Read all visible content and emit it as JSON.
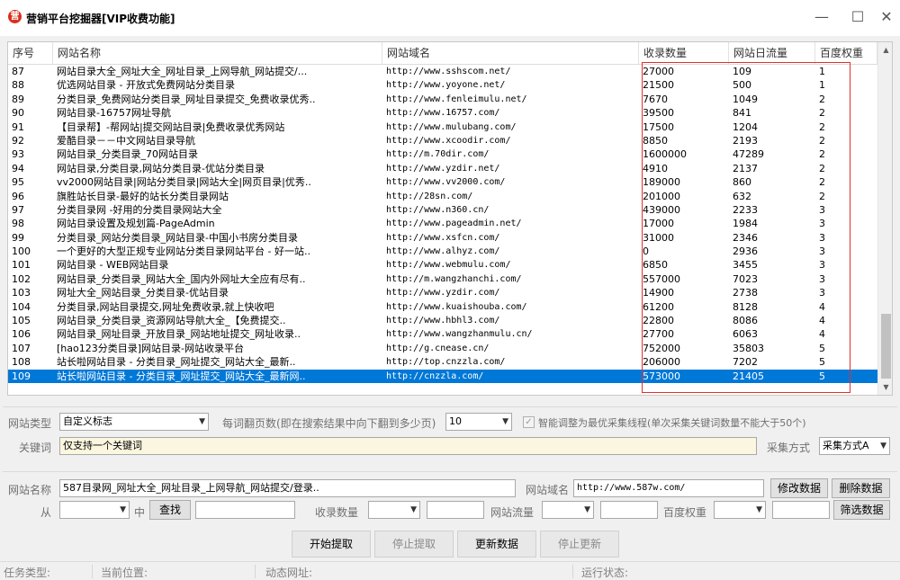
{
  "window": {
    "title": "营销平台挖掘器[VIP收费功能]",
    "icon_glyph": "营",
    "minimize": "—",
    "maximize": "☐",
    "close": "✕"
  },
  "grid": {
    "columns": [
      "序号",
      "网站名称",
      "网站域名",
      "收录数量",
      "网站日流量",
      "百度权重"
    ],
    "rows": [
      [
        "87",
        "网站目录大全_网址大全_网址目录_上网导航_网站提交/...",
        "http://www.sshscom.net/",
        "27000",
        "109",
        "1"
      ],
      [
        "88",
        "优选网站目录 - 开放式免费网站分类目录",
        "http://www.yoyone.net/",
        "21500",
        "500",
        "1"
      ],
      [
        "89",
        "分类目录_免费网站分类目录_网址目录提交_免费收录优秀..",
        "http://www.fenleimulu.net/",
        "7670",
        "1049",
        "2"
      ],
      [
        "90",
        "网站目录-16757网址导航",
        "http://www.16757.com/",
        "39500",
        "841",
        "2"
      ],
      [
        "91",
        "【目录帮】-帮网站|提交网站目录|免费收录优秀网站",
        "http://www.mulubang.com/",
        "17500",
        "1204",
        "2"
      ],
      [
        "92",
        "爱酷目录－－中文网站目录导航",
        "http://www.xcoodir.com/",
        "8850",
        "2193",
        "2"
      ],
      [
        "93",
        "网站目录_分类目录_70网站目录",
        "http://m.70dir.com/",
        "1600000",
        "47289",
        "2"
      ],
      [
        "94",
        "网站目录,分类目录,网站分类目录-优站分类目录",
        "http://www.yzdir.net/",
        "4910",
        "2137",
        "2"
      ],
      [
        "95",
        "vv2000网站目录|网站分类目录|网站大全|网页目录|优秀..",
        "http://www.vv2000.com/",
        "189000",
        "860",
        "2"
      ],
      [
        "96",
        "旗胜站长目录-最好的站长分类目录网站",
        "http://28sn.com/",
        "201000",
        "632",
        "2"
      ],
      [
        "97",
        "分类目录网 -好用的分类目录网站大全",
        "http://www.n360.cn/",
        "439000",
        "2233",
        "3"
      ],
      [
        "98",
        "网站目录设置及规划篇-PageAdmin",
        "http://www.pageadmin.net/",
        "17000",
        "1984",
        "3"
      ],
      [
        "99",
        "分类目录_网站分类目录_网站目录-中国小书房分类目录",
        "http://www.xsfcn.com/",
        "31000",
        "2346",
        "3"
      ],
      [
        "100",
        "一个更好的大型正规专业网站分类目录网站平台 - 好一站..",
        "http://www.alhyz.com/",
        "0",
        "2936",
        "3"
      ],
      [
        "101",
        "网站目录 - WEB网站目录",
        "http://www.webmulu.com/",
        "6850",
        "3455",
        "3"
      ],
      [
        "102",
        "网站目录_分类目录_网站大全_国内外网址大全应有尽有..",
        "http://m.wangzhanchi.com/",
        "557000",
        "7023",
        "3"
      ],
      [
        "103",
        "网址大全_网站目录_分类目录-优站目录",
        "http://www.yzdir.com/",
        "14900",
        "2738",
        "3"
      ],
      [
        "104",
        "分类目录,网站目录提交,网址免费收录,就上快收吧",
        "http://www.kuaishouba.com/",
        "61200",
        "8128",
        "4"
      ],
      [
        "105",
        "网站目录_分类目录_资源网站导航大全_【免费提交..",
        "http://www.hbhl3.com/",
        "22800",
        "8086",
        "4"
      ],
      [
        "106",
        "网站目录_网址目录_开放目录_网站地址提交_网址收录..",
        "http://www.wangzhanmulu.cn/",
        "27700",
        "6063",
        "4"
      ],
      [
        "107",
        "[hao123分类目录]网站目录-网站收录平台",
        "http://g.cnease.cn/",
        "752000",
        "35803",
        "5"
      ],
      [
        "108",
        "站长啦网站目录 - 分类目录_网址提交_网站大全_最新..",
        "http://top.cnzzla.com/",
        "206000",
        "7202",
        "5"
      ],
      [
        "109",
        "站长啦网站目录 - 分类目录_网址提交_网站大全_最新网..",
        "http://cnzzla.com/",
        "573000",
        "21405",
        "5"
      ]
    ],
    "selected_index": 22,
    "scroll_up": "▲",
    "scroll_down": "▼"
  },
  "settings": {
    "site_type_label": "网站类型",
    "site_type_value": "自定义标志",
    "pages_label": "每词翻页数(即在搜索结果中向下翻到多少页)",
    "pages_value": "10",
    "smart_thread_label": "智能调整为最优采集线程(单次采集关键词数量不能大于50个)",
    "smart_thread_checked": "✓",
    "keyword_label": "关键词",
    "keyword_value": "仅支持一个关键词",
    "collect_mode_label": "采集方式",
    "collect_mode_value": "采集方式A"
  },
  "editor": {
    "site_name_label": "网站名称",
    "site_name_value": "587目录网_网址大全_网址目录_上网导航_网站提交/登录..",
    "domain_label": "网站域名",
    "domain_value": "http://www.587w.com/",
    "modify_button": "修改数据",
    "delete_button": "删除数据",
    "from_label": "从",
    "in_label": "中",
    "find_button": "查找",
    "count_label": "收录数量",
    "traffic_label": "网站流量",
    "weight_label": "百度权重",
    "filter_button": "筛选数据"
  },
  "actions": {
    "start": "开始提取",
    "stop": "停止提取",
    "update": "更新数据",
    "stop_update": "停止更新"
  },
  "status": {
    "task_type": "任务类型:",
    "current_pos": "当前位置:",
    "dynamic_url": "动态网址:",
    "run_state": "运行状态:"
  },
  "colors": {
    "selection": "#0078d7",
    "highlight_box": "#e03030",
    "input_beige": "#fbf6df",
    "app_icon": "#d9301c"
  }
}
